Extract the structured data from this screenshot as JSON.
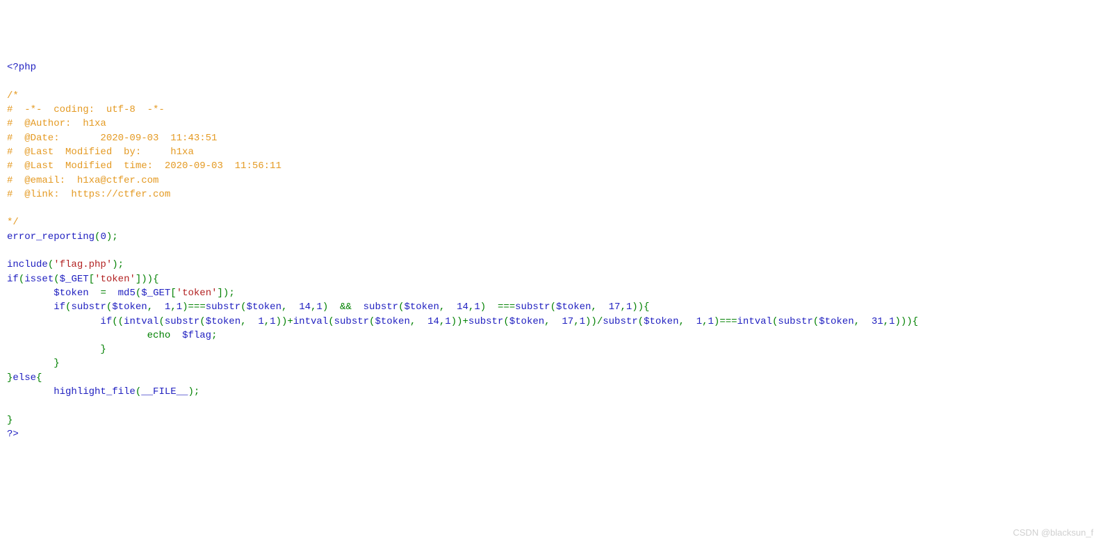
{
  "watermark": "CSDN @blacksun_fm",
  "code": {
    "open_tag": "<?php",
    "comment_block": {
      "open": "/*",
      "lines": [
        "#  -*-  coding:  utf-8  -*-",
        "#  @Author:  h1xa",
        "#  @Date:       2020-09-03  11:43:51",
        "#  @Last  Modified  by:     h1xa",
        "#  @Last  Modified  time:  2020-09-03  11:56:11",
        "#  @email:  h1xa@ctfer.com",
        "#  @link:  https://ctfer.com"
      ],
      "close": "*/"
    },
    "error_reporting": "error_reporting",
    "zero": "0",
    "include": "include",
    "flag_php": "'flag.php'",
    "if": "if",
    "isset": "isset",
    "get": "$_GET",
    "token_key": "'token'",
    "token_var": "$token",
    "md5": "md5",
    "substr": "substr",
    "intval": "intval",
    "echo": "echo",
    "flag_var": "$flag",
    "else": "else",
    "highlight_file": "highlight_file",
    "file_const": "__FILE__",
    "close_tag": "?>",
    "n1": "1",
    "n14": "14",
    "n17": "17",
    "n31": "31"
  }
}
